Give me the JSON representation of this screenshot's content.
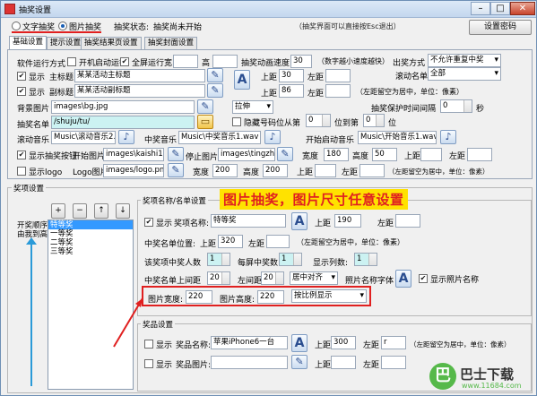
{
  "window": {
    "title": "抽奖设置",
    "minimize": "–",
    "maximize": "□",
    "close": "✕"
  },
  "top": {
    "mode_text": "文字抽奖",
    "mode_image": "图片抽奖",
    "status_label": "抽奖状态:",
    "status_value": "抽奖尚未开始",
    "note": "（抽奖界面可以直接按Esc退出）",
    "set_password": "设置密码"
  },
  "tabs": [
    "基础设置",
    "提示设置",
    "抽奖结果页设置",
    "抽奖封面设置"
  ],
  "basic": {
    "run_mode_label": "软件运行方式",
    "auto_run": "开机启动运行",
    "fullscreen": "全屏运行",
    "width_label": "宽",
    "width_value": "",
    "height_label": "高",
    "height_value": "",
    "speed_label": "抽奖动画速度",
    "speed_value": "30",
    "speed_hint": "（数字越小速度越快）",
    "out_mode_label": "出奖方式",
    "out_mode_value": "不允许重复中奖",
    "show": "显示",
    "main_title_label": "主标题",
    "main_title_value": "某某活动主标题",
    "sub_title_label": "副标题",
    "sub_title_value": "某某活动副标题",
    "top1_label": "上距",
    "top1_value": "30",
    "left1_label": "左距",
    "left1_value": "",
    "roll_list_label": "滚动名单",
    "roll_list_value": "全部",
    "top2_label": "上距",
    "top2_value": "86",
    "left2_label": "左距",
    "left2_value": "",
    "center_hint": "（左距留空为居中，单位：像素）",
    "bg_label": "背景图片",
    "bg_value": "images\\bg.jpg",
    "stretch_value": "拉伸",
    "interval_label": "抽奖保护时间间隔",
    "interval_value": "0",
    "interval_unit": "秒",
    "list_label": "抽奖名单",
    "list_value": "/shuju/tu/",
    "hide_mobile": "隐藏号码位",
    "from_label": "从第",
    "from_value": "0",
    "to_label": "位到第",
    "to_value": "0",
    "pos_label": "位",
    "roll_music_label": "滚动音乐",
    "roll_music_value": "Music\\滚动音乐2.wa",
    "win_music_label": "中奖音乐",
    "win_music_value": "Music\\中奖音乐1.wav",
    "start_music_label": "开始启动音乐",
    "start_music_value": "Music\\开始音乐1.wav",
    "show_btn": "显示抽奖按钮",
    "start_img_label": "开始图片",
    "start_img_value": "images\\kaishi1.p",
    "stop_img_label": "停止图片",
    "stop_img_value": "images\\tingzhi1.",
    "bw_label": "宽度",
    "bw_value": "180",
    "bh_label": "高度",
    "bh_value": "50",
    "btop_label": "上距",
    "btop_value": "",
    "bleft_label": "左距",
    "bleft_value": "",
    "show_logo": "显示logo",
    "logo_label": "Logo图片",
    "logo_value": "images/logo.png",
    "lw_label": "宽度",
    "lw_value": "200",
    "lh_label": "高度",
    "lh_value": "200",
    "ltop_label": "上距",
    "ltop_value": "",
    "lleft_label": "左距",
    "lleft_value": "",
    "center_hint2": "（左距留空为居中，单位：像素）"
  },
  "prize": {
    "group_label": "奖项设置",
    "add": "+",
    "remove": "−",
    "up": "↑",
    "down": "↓",
    "order_label": "开奖顺序由我到高",
    "items": [
      "特等奖",
      "一等奖",
      "二等奖",
      "三等奖"
    ],
    "name_group": "奖项名称/名单设置",
    "banner": "图片抽奖，图片尺寸任意设置",
    "show": "显示",
    "pname_label": "奖项名称:",
    "pname_value": "特等奖",
    "ptop_label": "上距",
    "ptop_value": "190",
    "pleft_label": "左距",
    "pleft_value": "",
    "listpos_label": "中奖名单位置:",
    "listtop_label": "上距",
    "listtop_value": "320",
    "listleft_label": "左距",
    "listleft_value": "",
    "center_hint": "（左距留空为居中，单位：像素）",
    "count_label": "该奖项中奖人数",
    "count_value": "1",
    "each_label": "每屏中奖数:",
    "each_value": "1",
    "cols_label": "显示列数:",
    "cols_value": "1",
    "winner_top_label": "中奖名单上间距",
    "winner_top_value": "20",
    "winner_left_label": "左间距",
    "winner_left_value": "20",
    "align_value": "居中对齐",
    "photo_font_label": "照片名称字体",
    "show_photo_name": "显示照片名称",
    "img_w_label": "图片宽度:",
    "img_w_value": "220",
    "img_h_label": "图片高度:",
    "img_h_value": "220",
    "ratio_value": "按比例显示"
  },
  "award": {
    "group_label": "奖品设置",
    "show": "显示",
    "name_label": "奖品名称:",
    "name_value": "苹果iPhone6一台",
    "top_label": "上距",
    "top_value": "300",
    "left_label": "左距",
    "left_value": "r",
    "hint": "（左距留空为居中，单位：像素）",
    "show2": "显示",
    "img_label": "奖品图片:",
    "img_value": "",
    "top2_label": "上距",
    "top2_value": "",
    "left2_label": "左距",
    "left2_value": ""
  },
  "watermark": {
    "logo_text": "巴士下载",
    "url": "www.11684.com"
  },
  "colors": {
    "accent_red": "#e02020",
    "banner_yellow": "#ffe200",
    "highlight_cyan": "#ccf2f2",
    "listbox_blue": "#3399ff",
    "watermark_green": "#56b94a"
  }
}
